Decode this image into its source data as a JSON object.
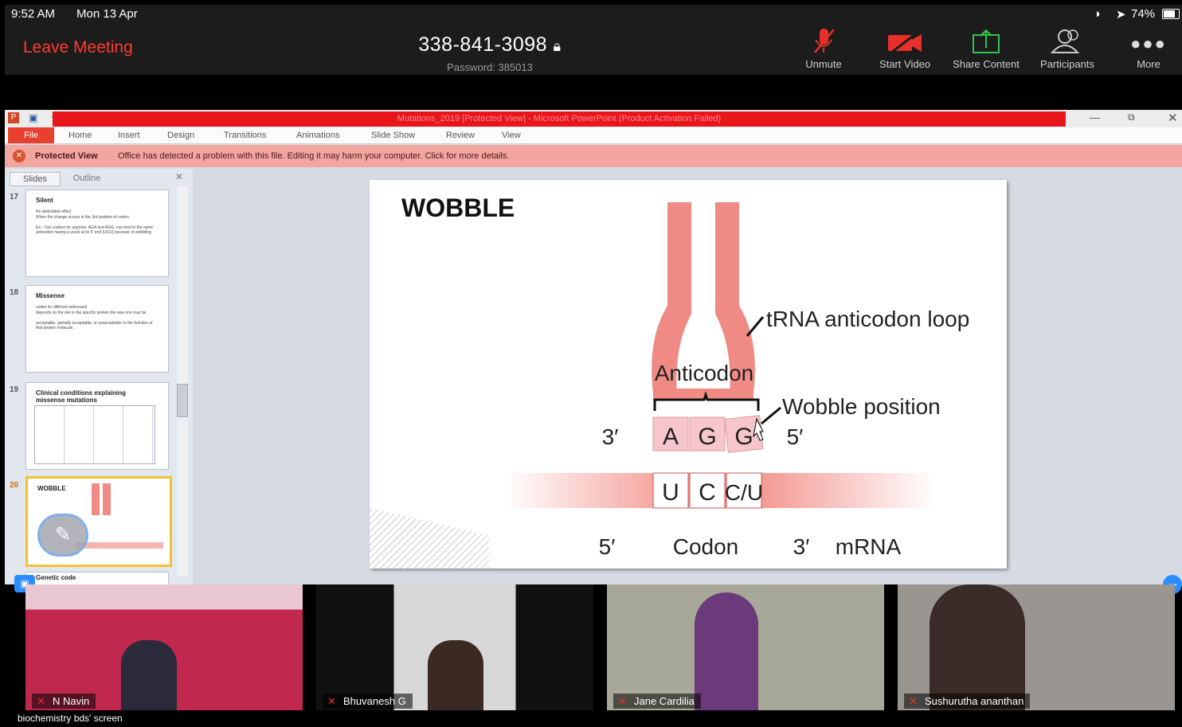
{
  "status": {
    "time": "9:52 AM",
    "date": "Mon 13 Apr",
    "battery": "74%"
  },
  "zoom": {
    "leave": "Leave Meeting",
    "meeting_id": "338-841-3098",
    "password": "Password: 385013",
    "toolbar": [
      {
        "label": "Unmute",
        "icon": "muted-mic-icon"
      },
      {
        "label": "Start Video",
        "icon": "video-off-icon"
      },
      {
        "label": "Share Content",
        "icon": "share-icon"
      },
      {
        "label": "Participants",
        "icon": "participants-icon"
      },
      {
        "label": "More",
        "icon": "more-icon"
      }
    ]
  },
  "ppt": {
    "title": "Mutations_2019 [Protected View] - Microsoft PowerPoint (Product Activation Failed)",
    "tabs": [
      "File",
      "Home",
      "Insert",
      "Design",
      "Transitions",
      "Animations",
      "Slide Show",
      "Review",
      "View"
    ],
    "protected_label": "Protected View",
    "protected_msg": "Office has detected a problem with this file. Editing it may harm your computer. Click for more details.",
    "panel_tabs": [
      "Slides",
      "Outline"
    ],
    "thumbs": [
      {
        "num": "17",
        "title": "Silent",
        "lines": [
          "No detectable effect",
          "When the change occurs in the 3rd position of codon.",
          "Ex:- Two codons for arginine, AGA and AGG, can bind to the same anticodon having a uracil at its 5' end (UCU) because of wobbling."
        ]
      },
      {
        "num": "18",
        "title": "Missense",
        "lines": [
          "codes for different aminoacid",
          "depends on the site in the specific protein the new one may be",
          "acceptable, partially acceptable, or unacceptable to the function of that protein molecule."
        ]
      },
      {
        "num": "19",
        "title": "Clinical conditions explaining missense mutations"
      },
      {
        "num": "20",
        "title": "WOBBLE"
      },
      {
        "num": "21",
        "title": "Genetic code"
      }
    ],
    "slide": {
      "title": "WOBBLE",
      "label_loop": "tRNA anticodon loop",
      "label_anticodon": "Anticodon",
      "label_wobble": "Wobble position",
      "three_prime": "3′",
      "five_prime": "5′",
      "anticodon_bases": [
        "A",
        "G",
        "G"
      ],
      "codon_bases": [
        "U",
        "C",
        "C/U"
      ],
      "bottom_5": "5′",
      "bottom_codon": "Codon",
      "bottom_3": "3′",
      "bottom_mrna": "mRNA"
    }
  },
  "participants": [
    "N Navin",
    "Bhuvanesh G",
    "Jane Cardilia",
    "Sushurutha ananthan"
  ],
  "footer": "biochemistry bds' screen",
  "colors": {
    "leave": "#ff3b30",
    "ppt_red": "#e8151b",
    "trna": "#f08a84"
  }
}
